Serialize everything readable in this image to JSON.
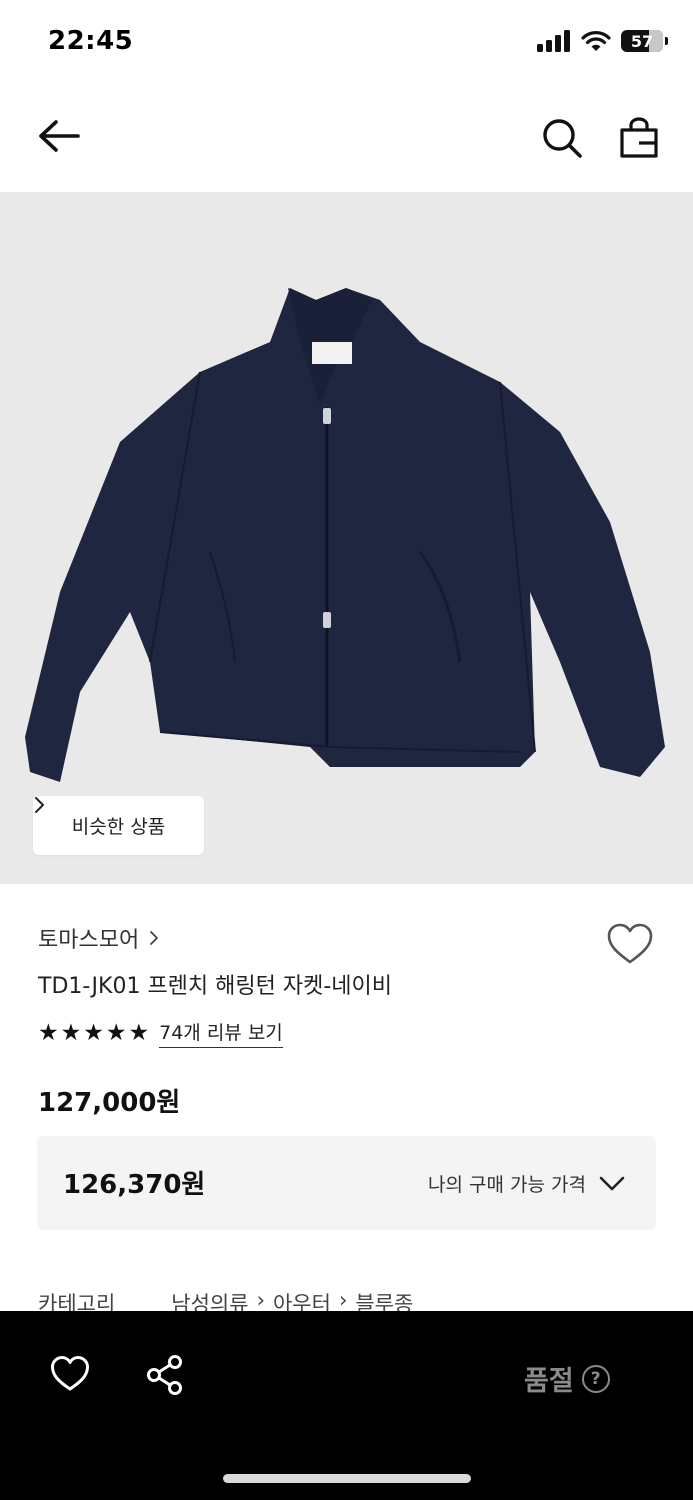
{
  "status_bar": {
    "time": "22:45",
    "battery": "57",
    "icons": [
      "signal-icon",
      "wifi-icon",
      "battery-icon"
    ]
  },
  "nav": {
    "icons": [
      "back-arrow-icon",
      "search-icon",
      "shopping-bag-icon"
    ]
  },
  "product_image": {
    "similar_button_label": "비슷한 상품",
    "background_color": "#e9e9ea",
    "garment_color": "#1f2640"
  },
  "product": {
    "brand": "토마스모어",
    "title": "TD1-JK01 프렌치 해링턴 자켓-네이비",
    "rating_stars": 5,
    "review_link": "74개 리뷰 보기",
    "price": "127,000원",
    "my_price": "126,370원",
    "my_price_label": "나의 구매 가능 가격"
  },
  "category": {
    "label": "카테고리",
    "path": [
      "남성의류",
      "아우터",
      "블루종"
    ]
  },
  "bottom_bar": {
    "status_label": "품절",
    "help_glyph": "?",
    "icons": [
      "heart-icon",
      "share-icon",
      "help-icon"
    ]
  }
}
